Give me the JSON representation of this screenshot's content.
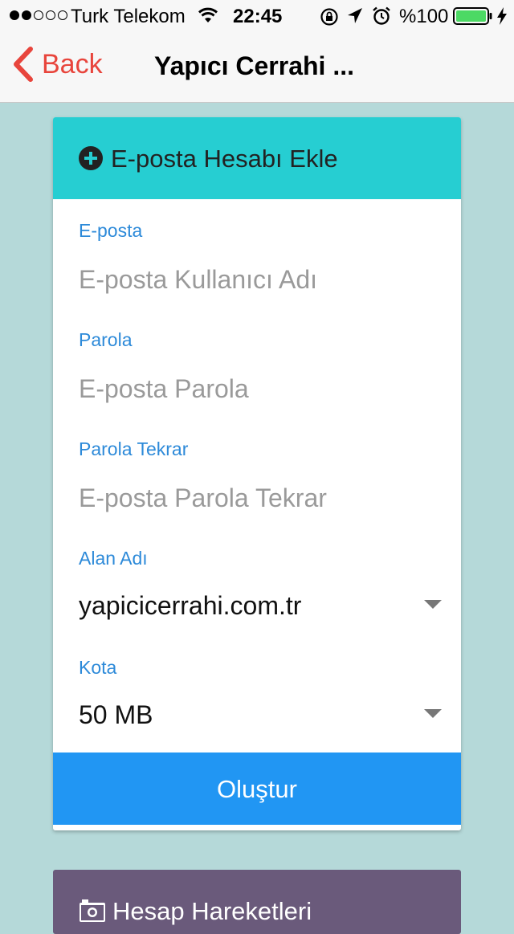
{
  "status_bar": {
    "carrier": "Turk Telekom",
    "time": "22:45",
    "battery_percent": "%100",
    "signal_bars": 2,
    "signal_total": 5,
    "battery_level": 1.0,
    "icons": [
      "wifi-icon",
      "rotation-lock-icon",
      "location-arrow-icon",
      "alarm-icon",
      "battery-icon",
      "charging-bolt-icon"
    ]
  },
  "nav": {
    "back_label": "Back",
    "title": "Yapıcı Cerrahi ...",
    "accent_color": "#e8453c"
  },
  "form": {
    "header_title": "E-posta Hesabı Ekle",
    "header_color": "#26ced2",
    "email_label": "E-posta",
    "email_placeholder": "E-posta Kullanıcı Adı",
    "email_value": "",
    "password_label": "Parola",
    "password_placeholder": "E-posta Parola",
    "password_value": "",
    "password_repeat_label": "Parola Tekrar",
    "password_repeat_placeholder": "E-posta Parola Tekrar",
    "password_repeat_value": "",
    "domain_label": "Alan Adı",
    "domain_value": "yapicicerrahi.com.tr",
    "quota_label": "Kota",
    "quota_value": "50 MB",
    "submit_label": "Oluştur",
    "submit_color": "#2196f3",
    "label_color": "#2d8ad9"
  },
  "next_card": {
    "title": "Hesap Hareketleri",
    "color": "#6a5a7b"
  }
}
